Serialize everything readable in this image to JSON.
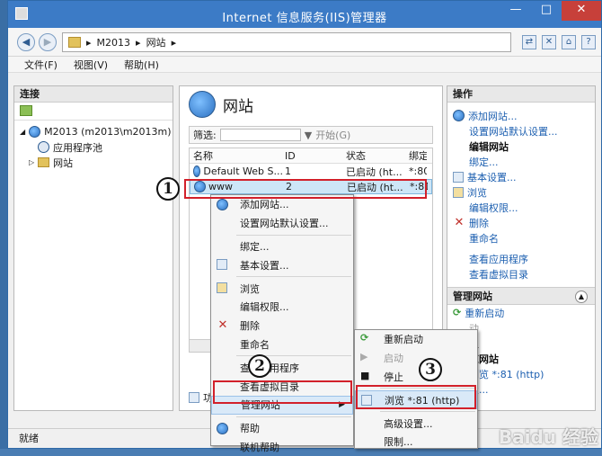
{
  "window": {
    "title": "Internet 信息服务(IIS)管理器"
  },
  "window_controls": {
    "minimize": "—",
    "maximize": "□",
    "close": "✕"
  },
  "address": {
    "crumbs": [
      "M2013",
      "网站"
    ],
    "sep": "▸"
  },
  "menu": {
    "file": "文件(F)",
    "view": "视图(V)",
    "help": "帮助(H)"
  },
  "left_pane": {
    "title": "连接",
    "tree": [
      {
        "label": "M2013 (m2013\\m2013m)",
        "expander": "◢"
      },
      {
        "label": "应用程序池"
      },
      {
        "label": "网站",
        "expander": "▷"
      }
    ]
  },
  "center": {
    "title": "网站",
    "filter_label": "筛选:",
    "start_label": "开始(G)",
    "columns": [
      "名称",
      "ID",
      "状态",
      "绑定"
    ],
    "rows": [
      {
        "name": "Default Web S...",
        "id": "1",
        "status": "已启动 (ht...",
        "binding": "*:80"
      },
      {
        "name": "www",
        "id": "2",
        "status": "已启动 (ht...",
        "binding": "*:81"
      }
    ],
    "tab": "功能"
  },
  "actions": {
    "title": "操作",
    "items": [
      "添加网站...",
      "设置网站默认设置..."
    ],
    "edit_head": "编辑网站",
    "edit_items": [
      "绑定...",
      "基本设置..."
    ],
    "browse_items": [
      "浏览",
      "编辑权限..."
    ],
    "delete": "删除",
    "rename": "重命名",
    "view_items": [
      "查看应用程序",
      "查看虚拟目录"
    ],
    "manage_head": "管理网站",
    "restart": "重新启动",
    "start_frag": "动",
    "stop_frag": "止",
    "browse_site_head": "览网站",
    "browse_81": "浏览 *:81 (http)",
    "adv_frag": "置..."
  },
  "context_menu": {
    "items": [
      "添加网站...",
      "设置网站默认设置...",
      "绑定...",
      "基本设置...",
      "浏览",
      "编辑权限...",
      "删除",
      "重命名",
      "查看应用程序",
      "查看虚拟目录",
      "管理网站",
      "帮助",
      "联机帮助"
    ],
    "arrow": "▶"
  },
  "sub_menu": {
    "items": [
      "重新启动",
      "启动",
      "停止",
      "浏览 *:81 (http)",
      "高级设置...",
      "限制..."
    ]
  },
  "annotations": {
    "one": "1",
    "two": "2",
    "three": "3"
  },
  "status": {
    "text": "就绪"
  },
  "watermark": "Baidu 经验"
}
